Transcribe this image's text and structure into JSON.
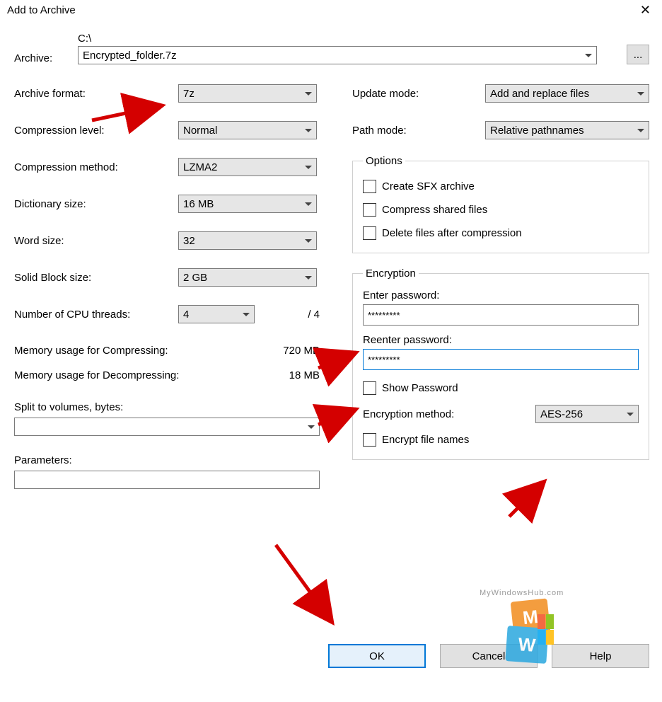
{
  "title": "Add to Archive",
  "archive": {
    "label": "Archive:",
    "path": "C:\\",
    "file": "Encrypted_folder.7z",
    "browse": "..."
  },
  "left": {
    "format": {
      "label": "Archive format:",
      "value": "7z"
    },
    "level": {
      "label": "Compression level:",
      "value": "Normal"
    },
    "method": {
      "label": "Compression method:",
      "value": "LZMA2"
    },
    "dict": {
      "label": "Dictionary size:",
      "value": "16 MB"
    },
    "word": {
      "label": "Word size:",
      "value": "32"
    },
    "solid": {
      "label": "Solid Block size:",
      "value": "2 GB"
    },
    "threads": {
      "label": "Number of CPU threads:",
      "value": "4",
      "of": "/ 4"
    },
    "memc": {
      "label": "Memory usage for Compressing:",
      "value": "720 MB"
    },
    "memd": {
      "label": "Memory usage for Decompressing:",
      "value": "18 MB"
    },
    "split": {
      "label": "Split to volumes, bytes:",
      "value": ""
    },
    "params": {
      "label": "Parameters:",
      "value": ""
    }
  },
  "right": {
    "update": {
      "label": "Update mode:",
      "value": "Add and replace files"
    },
    "path": {
      "label": "Path mode:",
      "value": "Relative pathnames"
    },
    "options": {
      "legend": "Options",
      "sfx": "Create SFX archive",
      "shared": "Compress shared files",
      "delete": "Delete files after compression"
    },
    "encryption": {
      "legend": "Encryption",
      "enter": "Enter password:",
      "pass1": "*********",
      "reenter": "Reenter password:",
      "pass2": "*********",
      "show": "Show Password",
      "method_l": "Encryption method:",
      "method_v": "AES-256",
      "encnames": "Encrypt file names"
    }
  },
  "buttons": {
    "ok": "OK",
    "cancel": "Cancel",
    "help": "Help"
  },
  "watermark": "MyWindowsHub.com"
}
